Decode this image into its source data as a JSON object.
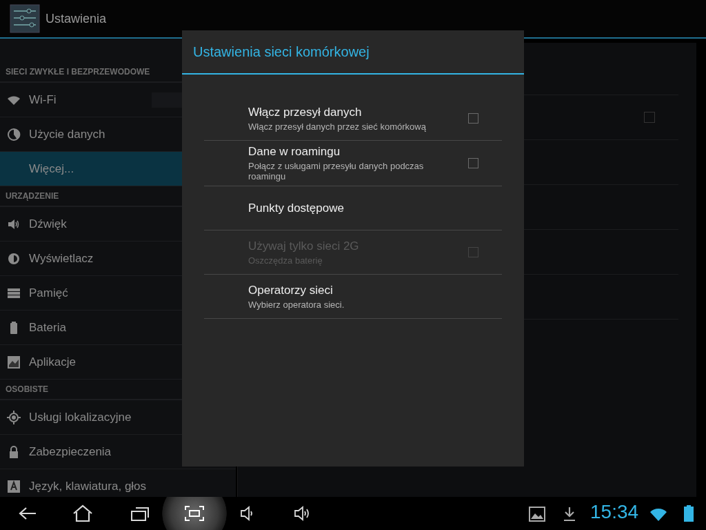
{
  "action_bar": {
    "title": "Ustawienia"
  },
  "sidebar": {
    "sections": [
      {
        "header": "SIECI ZWYKŁE I BEZPRZEWODOWE",
        "items": [
          {
            "label": "Wi-Fi",
            "kind": "wifi",
            "selected": false,
            "has_toggle": true
          },
          {
            "label": "Użycie danych",
            "kind": "pie",
            "selected": false,
            "has_toggle": false
          },
          {
            "label": "Więcej...",
            "kind": "none",
            "selected": true,
            "has_toggle": false
          }
        ]
      },
      {
        "header": "URZĄDZENIE",
        "items": [
          {
            "label": "Dźwięk",
            "kind": "speaker",
            "selected": false,
            "has_toggle": false
          },
          {
            "label": "Wyświetlacz",
            "kind": "brightness",
            "selected": false,
            "has_toggle": false
          },
          {
            "label": "Pamięć",
            "kind": "storage",
            "selected": false,
            "has_toggle": false
          },
          {
            "label": "Bateria",
            "kind": "battery",
            "selected": false,
            "has_toggle": false
          },
          {
            "label": "Aplikacje",
            "kind": "apps",
            "selected": false,
            "has_toggle": false
          }
        ]
      },
      {
        "header": "OSOBISTE",
        "items": [
          {
            "label": "Usługi lokalizacyjne",
            "kind": "location",
            "selected": false,
            "has_toggle": false
          },
          {
            "label": "Zabezpieczenia",
            "kind": "lock",
            "selected": false,
            "has_toggle": false
          },
          {
            "label": "Język, klawiatura, głos",
            "kind": "keyboard",
            "selected": false,
            "has_toggle": false
          }
        ]
      }
    ]
  },
  "background_list": {
    "checkbox_checked": false
  },
  "dialog": {
    "title": "Ustawienia sieci komórkowej",
    "items": [
      {
        "kind": "checkbox",
        "title": "Włącz przesył danych",
        "summary": "Włącz przesył danych przez sieć komórkową",
        "checked": false,
        "disabled": false
      },
      {
        "kind": "checkbox",
        "title": "Dane w roamingu",
        "summary": "Połącz z usługami przesyłu danych podczas roamingu",
        "checked": false,
        "disabled": false
      },
      {
        "kind": "plain",
        "title": "Punkty dostępowe",
        "disabled": false
      },
      {
        "kind": "checkbox",
        "title": "Używaj tylko sieci 2G",
        "summary": "Oszczędza baterię",
        "checked": false,
        "disabled": true
      },
      {
        "kind": "plain",
        "title": "Operatorzy sieci",
        "summary": "Wybierz operatora sieci.",
        "disabled": false
      }
    ]
  },
  "nav_bar": {
    "screenshot_pressed": true,
    "clock": "15:34"
  }
}
